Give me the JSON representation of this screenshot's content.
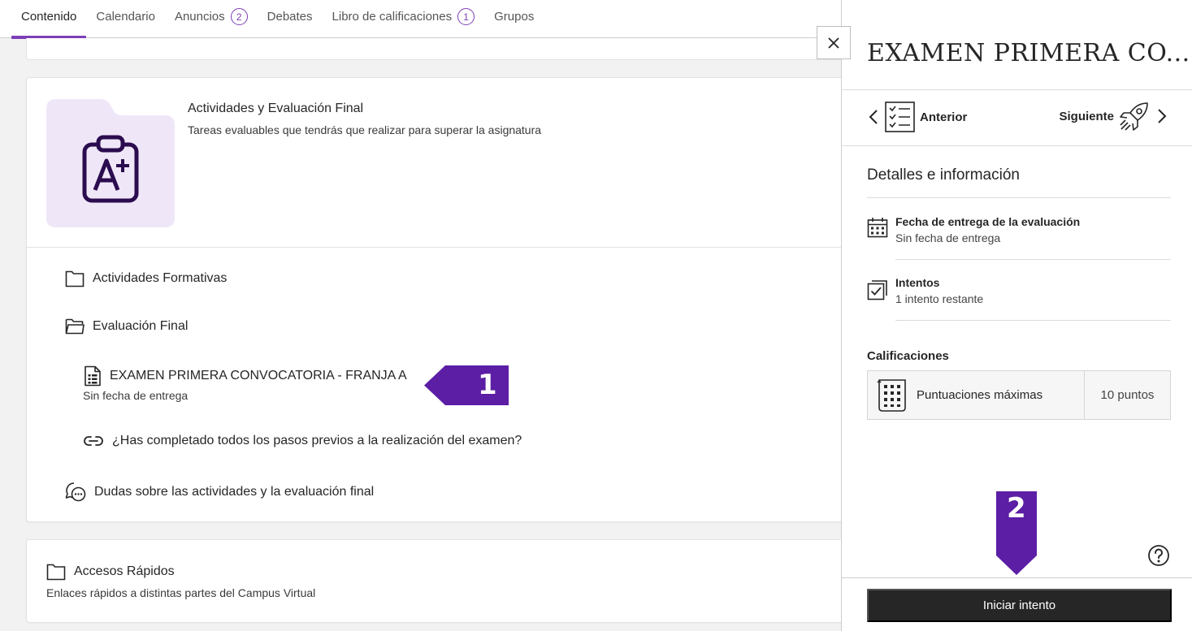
{
  "tabs": [
    {
      "label": "Contenido",
      "badge": null,
      "active": true
    },
    {
      "label": "Calendario",
      "badge": null
    },
    {
      "label": "Anuncios",
      "badge": "2"
    },
    {
      "label": "Debates",
      "badge": null
    },
    {
      "label": "Libro de calificaciones",
      "badge": "1"
    },
    {
      "label": "Grupos",
      "badge": null
    }
  ],
  "folder": {
    "icon": "grade-clipboard-icon",
    "title": "Actividades y Evaluación Final",
    "description": "Tareas evaluables que tendrás que realizar para superar la asignatura",
    "items": {
      "formativas": "Actividades Formativas",
      "evaluacion": "Evaluación Final",
      "exam": "EXAMEN PRIMERA CONVOCATORIA - FRANJA A",
      "exam_sub": "Sin fecha de entrega",
      "link": "¿Has completado todos los pasos previos a la realización del examen?",
      "dudas": "Dudas sobre las actividades y la evaluación final"
    }
  },
  "quick_access": {
    "title": "Accesos Rápidos",
    "description": "Enlaces rápidos a distintas partes del Campus Virtual"
  },
  "callouts": {
    "first": "1",
    "second": "2"
  },
  "panel": {
    "title": "EXAMEN PRIMERA CO...",
    "prev_label": "Anterior",
    "next_label": "Siguiente",
    "details_heading": "Detalles e información",
    "due_title": "Fecha de entrega de la evaluación",
    "due_value": "Sin fecha de entrega",
    "attempts_title": "Intentos",
    "attempts_value": "1 intento restante",
    "grades_heading": "Calificaciones",
    "max_score_label": "Puntuaciones máximas",
    "max_score_value": "10 puntos",
    "start_button": "Iniciar intento"
  },
  "colors": {
    "accent": "#7c3eb6",
    "callout": "#5b1ea5",
    "folder_tile": "#efe7f8",
    "button_dark": "#262626"
  }
}
